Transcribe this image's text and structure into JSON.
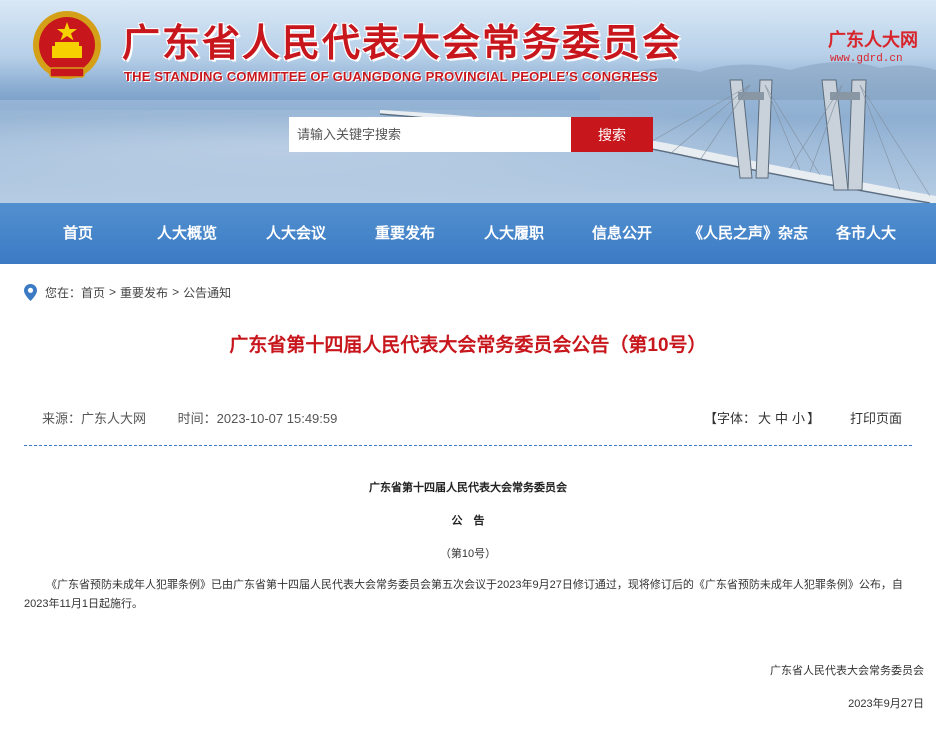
{
  "header": {
    "title_cn": "广东省人民代表大会常务委员会",
    "title_en": "THE STANDING COMMITTEE OF GUANGDONG PROVINCIAL PEOPLE’S CONGRESS",
    "brand": "广东人大网",
    "brand_url": "www.gdrd.cn",
    "emblem_icon": "national-emblem-icon"
  },
  "search": {
    "placeholder": "请输入关键字搜索",
    "button_label": "搜索"
  },
  "nav": {
    "items": [
      {
        "label": "首页"
      },
      {
        "label": "人大概览"
      },
      {
        "label": "人大会议"
      },
      {
        "label": "重要发布"
      },
      {
        "label": "人大履职"
      },
      {
        "label": "信息公开"
      },
      {
        "label": "《人民之声》杂志"
      },
      {
        "label": "各市人大"
      }
    ]
  },
  "breadcrumb": {
    "icon": "location-pin-icon",
    "prefix": "您在：",
    "items": [
      "首页",
      "重要发布",
      "公告通知"
    ],
    "separator": ">"
  },
  "article": {
    "title": "广东省第十四届人民代表大会常务委员会公告（第10号）",
    "source": "来源：广东人大网",
    "time": "时间：2023-10-07 15:49:59",
    "font_label_open": "【字体：",
    "font_sizes": [
      "大",
      "中",
      "小"
    ],
    "font_label_close": "】",
    "print_label": "打印页面",
    "body": {
      "heading": "广东省第十四届人民代表大会常务委员会",
      "subheading": "公　告",
      "number": "（第10号）",
      "paragraph": "《广东省预防未成年人犯罪条例》已由广东省第十四届人民代表大会常务委员会第五次会议于2023年9月27日修订通过，现将修订后的《广东省预防未成年人犯罪条例》公布，自2023年11月1日起施行。",
      "signature": "广东省人民代表大会常务委员会",
      "date": "2023年9月27日"
    }
  },
  "colors": {
    "brand_red": "#c8161d",
    "nav_blue": "#3c7bc4",
    "divider_blue": "#3c7bc4"
  }
}
